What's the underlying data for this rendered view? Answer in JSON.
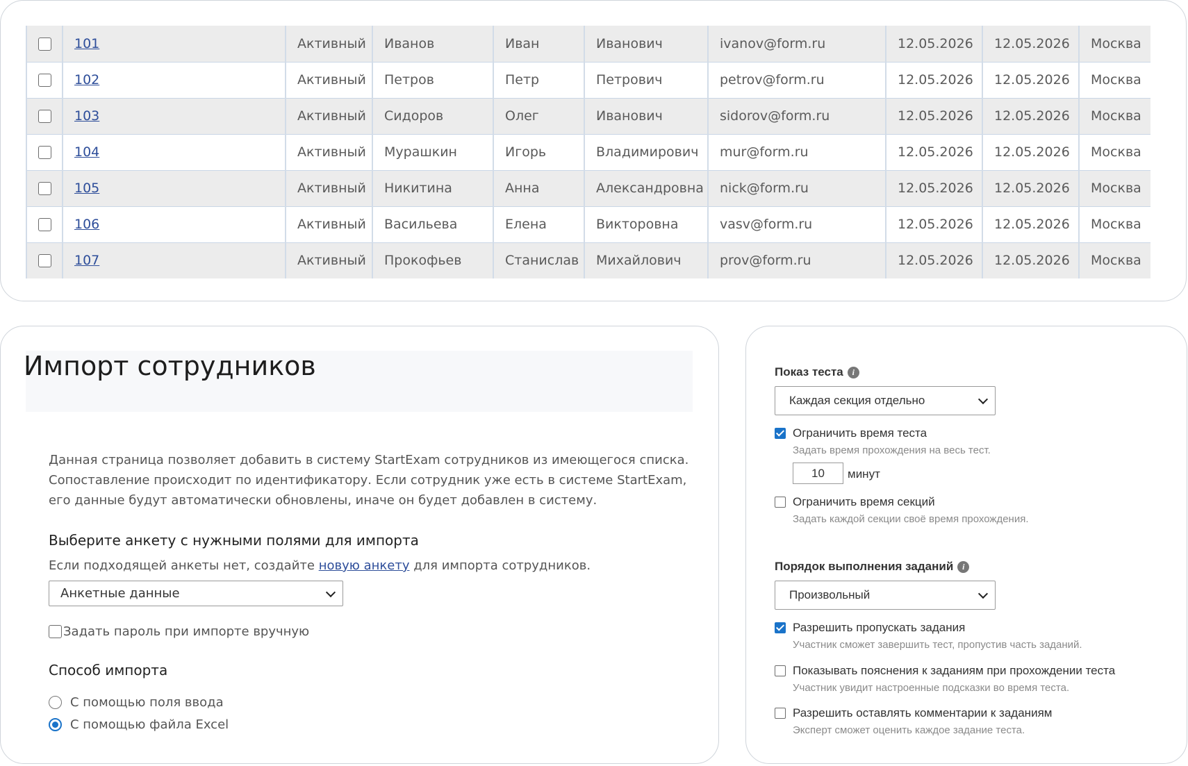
{
  "table": {
    "rows": [
      {
        "id": "101",
        "status": "Активный",
        "last": "Иванов",
        "first": "Иван",
        "middle": "Иванович",
        "email": "ivanov@form.ru",
        "date1": "12.05.2026",
        "date2": "12.05.2026",
        "city": "Москва"
      },
      {
        "id": "102",
        "status": "Активный",
        "last": "Петров",
        "first": "Петр",
        "middle": "Петрович",
        "email": "petrov@form.ru",
        "date1": "12.05.2026",
        "date2": "12.05.2026",
        "city": "Москва"
      },
      {
        "id": "103",
        "status": "Активный",
        "last": "Сидоров",
        "first": "Олег",
        "middle": "Иванович",
        "email": "sidorov@form.ru",
        "date1": "12.05.2026",
        "date2": "12.05.2026",
        "city": "Москва"
      },
      {
        "id": "104",
        "status": "Активный",
        "last": "Мурашкин",
        "first": "Игорь",
        "middle": "Владимирович",
        "email": "mur@form.ru",
        "date1": "12.05.2026",
        "date2": "12.05.2026",
        "city": "Москва"
      },
      {
        "id": "105",
        "status": "Активный",
        "last": "Никитина",
        "first": "Анна",
        "middle": "Александровна",
        "email": "nick@form.ru",
        "date1": "12.05.2026",
        "date2": "12.05.2026",
        "city": "Москва"
      },
      {
        "id": "106",
        "status": "Активный",
        "last": "Васильева",
        "first": "Елена",
        "middle": "Викторовна",
        "email": "vasv@form.ru",
        "date1": "12.05.2026",
        "date2": "12.05.2026",
        "city": "Москва"
      },
      {
        "id": "107",
        "status": "Активный",
        "last": "Прокофьев",
        "first": "Станислав",
        "middle": "Михайлович",
        "email": "prov@form.ru",
        "date1": "12.05.2026",
        "date2": "12.05.2026",
        "city": "Москва"
      }
    ]
  },
  "import": {
    "title": "Импорт сотрудников",
    "description": "Данная страница позволяет добавить в систему StartExam сотрудников из имеющегося списка. Сопоставление происходит по идентификатору. Если сотрудник уже есть в системе StartExam, его данные будут автоматически обновлены, иначе он будет добавлен в систему.",
    "form_heading": "Выберите анкету с нужными полями для импорта",
    "hint_before": "Если подходящей анкеты нет, создайте ",
    "hint_link": "новую анкету",
    "hint_after": " для импорта сотрудников.",
    "form_select": "Анкетные данные",
    "manual_password_label": "Задать пароль при импорте вручную",
    "method_heading": "Способ импорта",
    "method_options": [
      "С помощью поля ввода",
      "С помощью файла Excel"
    ]
  },
  "settings": {
    "display_label": "Показ теста",
    "display_select": "Каждая секция отдельно",
    "limit_time_label": "Ограничить время теста",
    "limit_time_note": "Задать время прохождения на весь тест.",
    "minutes_value": "10",
    "minutes_unit": "минут",
    "limit_sections_label": "Ограничить время секций",
    "limit_sections_note": "Задать каждой секции своё время прохождения.",
    "order_label": "Порядок выполнения заданий",
    "order_select": "Произвольный",
    "skip_label": "Разрешить пропускать задания",
    "skip_note": "Участник сможет завершить тест, пропустив часть заданий.",
    "hints_label": "Показывать пояснения к заданиям при прохождении теста",
    "hints_note": "Участник увидит настроенные подсказки во время теста.",
    "comments_label": "Разрешить оставлять комментарии к заданиям",
    "comments_note": "Эксперт сможет оценить каждое задание теста."
  },
  "colors": {
    "accent": "#1a73c9",
    "link": "#2e4e9a",
    "row_alt": "#ececec"
  },
  "icons": {
    "info": "info-icon",
    "dropdown": "chevron-down-icon"
  }
}
